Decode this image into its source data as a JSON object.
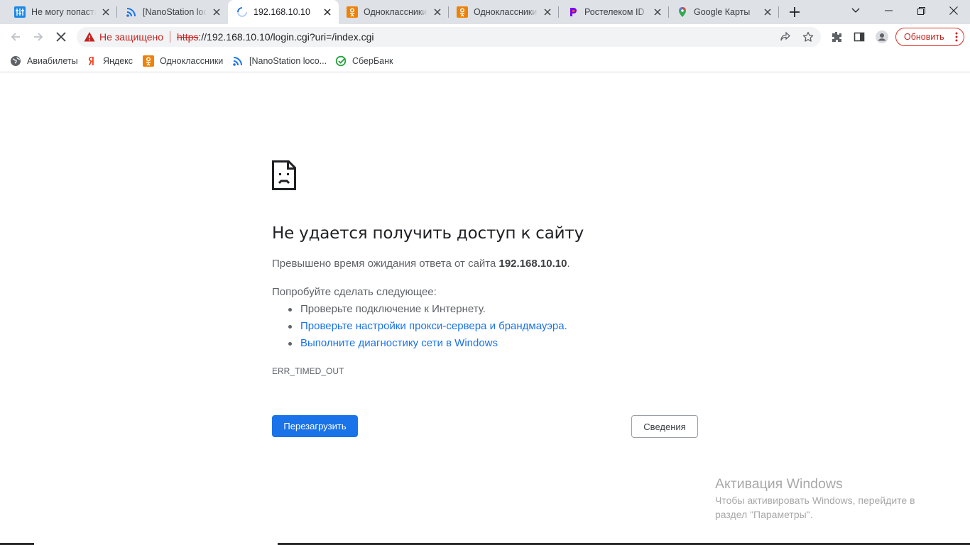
{
  "tabs": [
    {
      "title": "Не могу попасть",
      "icon": "forum-icon",
      "active": false
    },
    {
      "title": "[NanoStation loco",
      "icon": "rss-icon",
      "active": false
    },
    {
      "title": "192.168.10.10",
      "icon": "loading-spinner-icon",
      "active": true
    },
    {
      "title": "Одноклассники",
      "icon": "ok-icon",
      "active": false
    },
    {
      "title": "Одноклассники",
      "icon": "ok-icon",
      "active": false
    },
    {
      "title": "Ростелеком ID",
      "icon": "rostelecom-icon",
      "active": false
    },
    {
      "title": "Google Карты",
      "icon": "google-maps-icon",
      "active": false
    }
  ],
  "omnibox": {
    "security_label": "Не защищено",
    "scheme": "https",
    "url_rest": "://192.168.10.10/login.cgi?uri=/index.cgi"
  },
  "update_button": "Обновить",
  "bookmarks": [
    {
      "label": "Авиабилеты",
      "icon": "globe-icon"
    },
    {
      "label": "Яндекс",
      "icon": "yandex-icon"
    },
    {
      "label": "Одноклассники",
      "icon": "ok-icon"
    },
    {
      "label": "[NanoStation loco...",
      "icon": "rss-icon"
    },
    {
      "label": "СберБанк",
      "icon": "sberbank-icon"
    }
  ],
  "error": {
    "title": "Не удается получить доступ к сайту",
    "desc_prefix": "Превышено время ожидания ответа от сайта ",
    "host": "192.168.10.10",
    "desc_suffix": ".",
    "try_label": "Попробуйте сделать следующее:",
    "suggestions": [
      "Проверьте подключение к Интернету.",
      "Проверьте настройки прокси-сервера и брандмауэра.",
      "Выполните диагностику сети в Windows"
    ],
    "code": "ERR_TIMED_OUT",
    "reload_label": "Перезагрузить",
    "details_label": "Сведения"
  },
  "activation": {
    "title": "Активация Windows",
    "text": "Чтобы активировать Windows, перейдите в раздел \"Параметры\"."
  },
  "colors": {
    "accent": "#1a73e8",
    "danger": "#c5221f",
    "tabstrip": "#dee1e6"
  }
}
